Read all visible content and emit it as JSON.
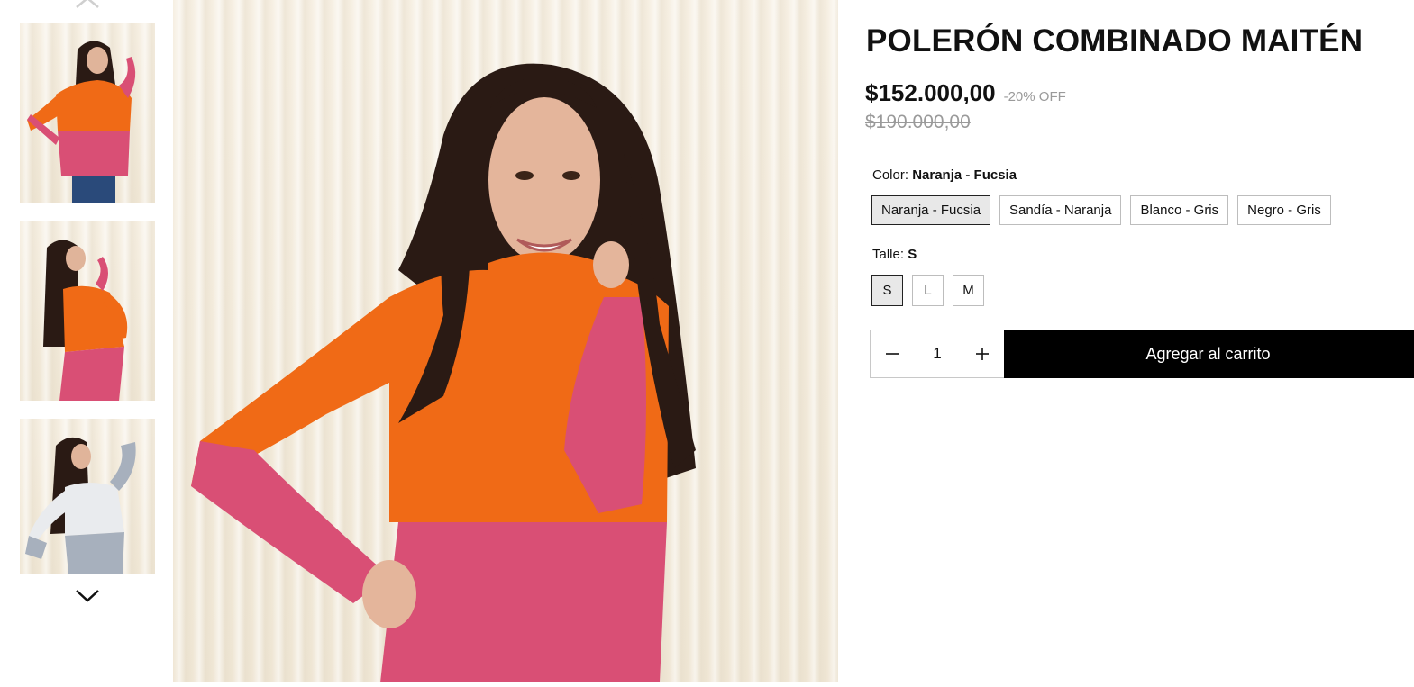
{
  "product": {
    "title": "POLERÓN COMBINADO MAITÉN",
    "price": "$152.000,00",
    "discount": "-20% OFF",
    "old_price": "$190.000,00"
  },
  "color_option": {
    "label": "Color:",
    "selected": "Naranja - Fucsia",
    "options": [
      "Naranja - Fucsia",
      "Sandía - Naranja",
      "Blanco - Gris",
      "Negro - Gris"
    ]
  },
  "size_option": {
    "label": "Talle:",
    "selected": "S",
    "options": [
      "S",
      "L",
      "M"
    ]
  },
  "quantity": {
    "value": "1"
  },
  "cart": {
    "add_label": "Agregar al carrito"
  },
  "gallery": {
    "icons": {
      "previous": "chevron-up-icon",
      "next": "chevron-down-icon",
      "decrease": "minus-icon",
      "increase": "plus-icon"
    }
  },
  "colors": {
    "orange": "#f06a16",
    "pink": "#d94f75",
    "hair": "#2a1a14",
    "curtain": "#f3ebdb",
    "button_bg": "#000000",
    "muted_text": "#9a9a9a",
    "selected_bg": "#e8e8e8"
  }
}
